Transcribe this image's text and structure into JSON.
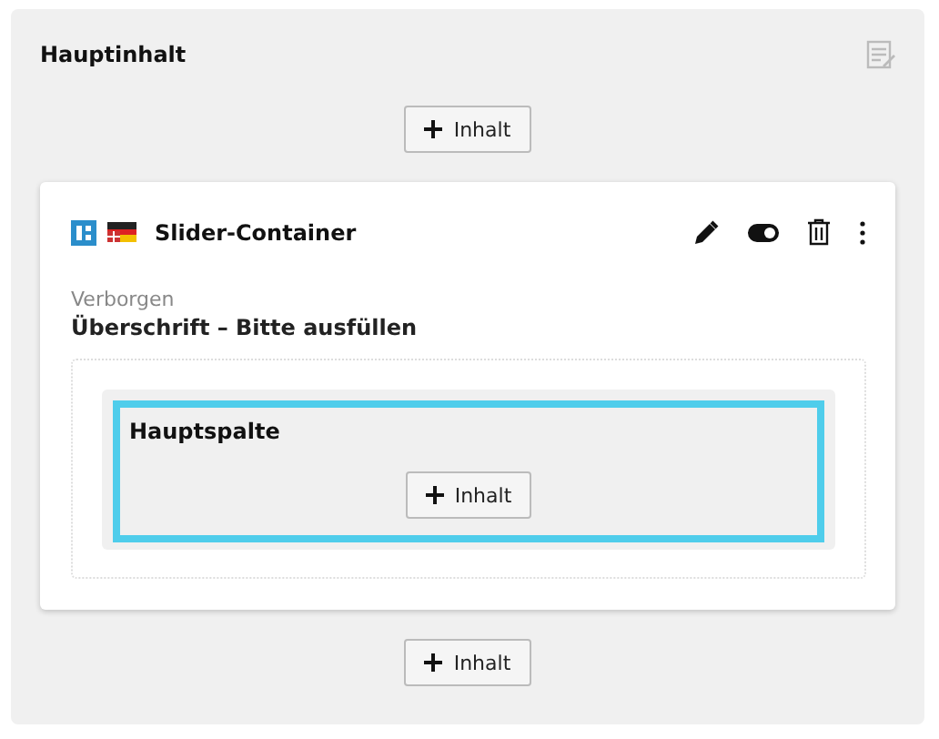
{
  "section": {
    "title": "Hauptinhalt"
  },
  "add_buttons": [
    {
      "label": "Inhalt"
    },
    {
      "label": "Inhalt"
    }
  ],
  "element": {
    "title": "Slider-Container",
    "status": "Verborgen",
    "heading": "Überschrift – Bitte ausfüllen",
    "column": {
      "title": "Hauptspalte",
      "highlighted": true,
      "add_label": "Inhalt"
    }
  }
}
